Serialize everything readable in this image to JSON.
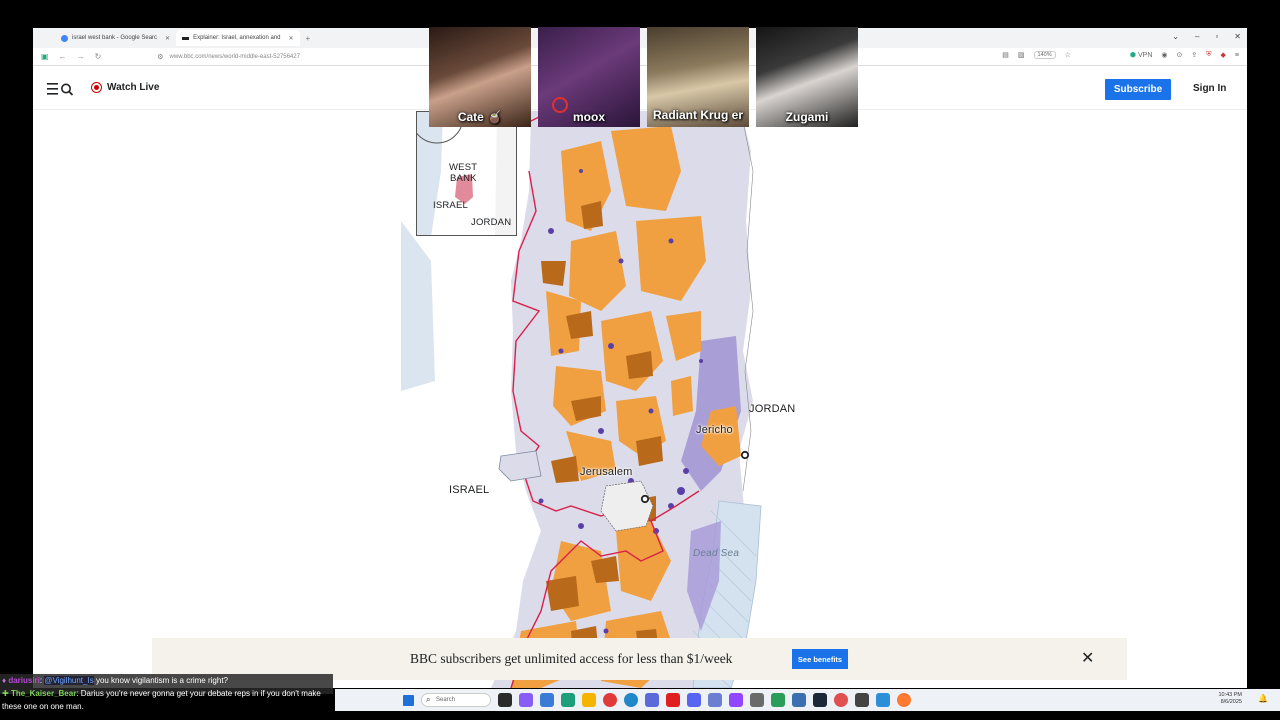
{
  "browser": {
    "tabs": [
      {
        "label": "israel west bank - Google Searc",
        "active": false
      },
      {
        "label": "Explainer: Israel, annexation and",
        "active": true
      }
    ],
    "url": "www.bbc.com/news/world-middle-east-52756427",
    "zoom": "140%",
    "vpn_label": "VPN"
  },
  "header": {
    "watch_live": "Watch Live",
    "subscribe": "Subscribe",
    "sign_in": "Sign In"
  },
  "map": {
    "inset_labels": {
      "west": "WEST",
      "bank": "BANK",
      "israel": "ISRAEL",
      "jordan": "JORDAN"
    },
    "labels": {
      "jordan": "JORDAN",
      "israel": "ISRAEL",
      "jericho": "Jericho",
      "jerusalem": "Jerusalem",
      "dead_sea": "Dead Sea"
    },
    "colors": {
      "area_a_orange": "#f0a040",
      "area_b_brown": "#b86a1a",
      "area_c_lavender": "#dcdbe9",
      "settlement_purple": "#6a50b8",
      "barrier_red": "#d8204a",
      "israel_white": "#ffffff",
      "jordan_white": "#ffffff",
      "sea_blue": "#cfdced"
    }
  },
  "banner": {
    "text": "BBC subscribers get unlimited access for less than $1/week",
    "button": "See benefits",
    "close_icon": "close-icon"
  },
  "stream": {
    "cams": [
      {
        "name": "Cate 🧉"
      },
      {
        "name": "moox"
      },
      {
        "name": "Radiant Krug er"
      },
      {
        "name": "Zugami"
      }
    ],
    "chat": [
      {
        "user": "dariusiri",
        "mention": "@Vigilhunt_Is",
        "text": "you know vigilantism is a crime right?"
      },
      {
        "user": "The_Kaiser_Bear",
        "text": "Darius you're never gonna get your debate reps in if you don't make these one on one man."
      }
    ]
  },
  "taskbar": {
    "search_placeholder": "Search",
    "time": "10:43 PM",
    "date": "8/6/2025"
  }
}
